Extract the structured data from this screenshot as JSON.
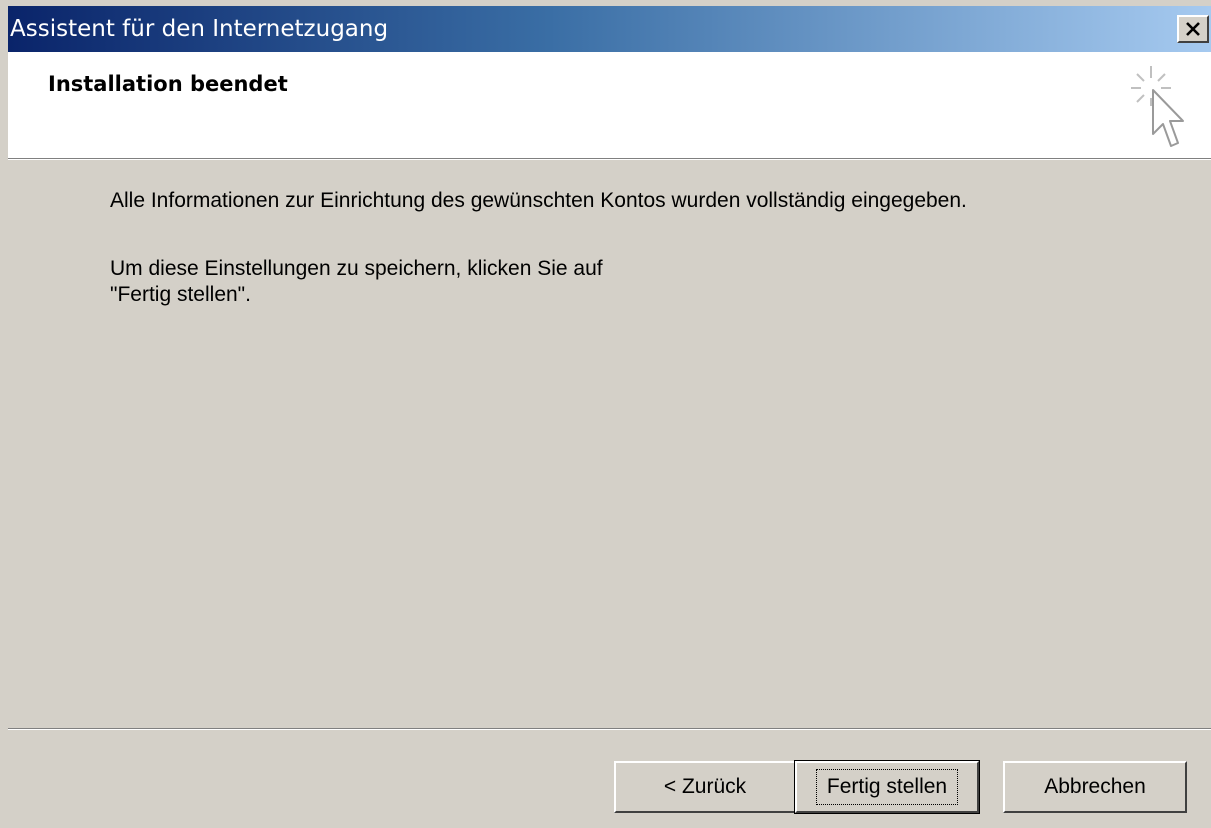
{
  "window": {
    "title": "Assistent für den Internetzugang",
    "close_icon": "close-icon"
  },
  "header": {
    "title": "Installation beendet",
    "icon": "wizard-cursor-icon"
  },
  "content": {
    "paragraph1": "Alle Informationen zur Einrichtung des gewünschten Kontos wurden vollständig eingegeben.",
    "paragraph2_line1": "Um diese Einstellungen zu speichern, klicken Sie auf",
    "paragraph2_line2": "\"Fertig stellen\"."
  },
  "buttons": {
    "back_label": "< Zurück",
    "finish_label": "Fertig stellen",
    "cancel_label": "Abbrechen"
  },
  "colors": {
    "titlebar_start": "#0a246a",
    "titlebar_end": "#a6caf0",
    "dialog_face": "#d4d0c8",
    "header_background": "#ffffff"
  }
}
